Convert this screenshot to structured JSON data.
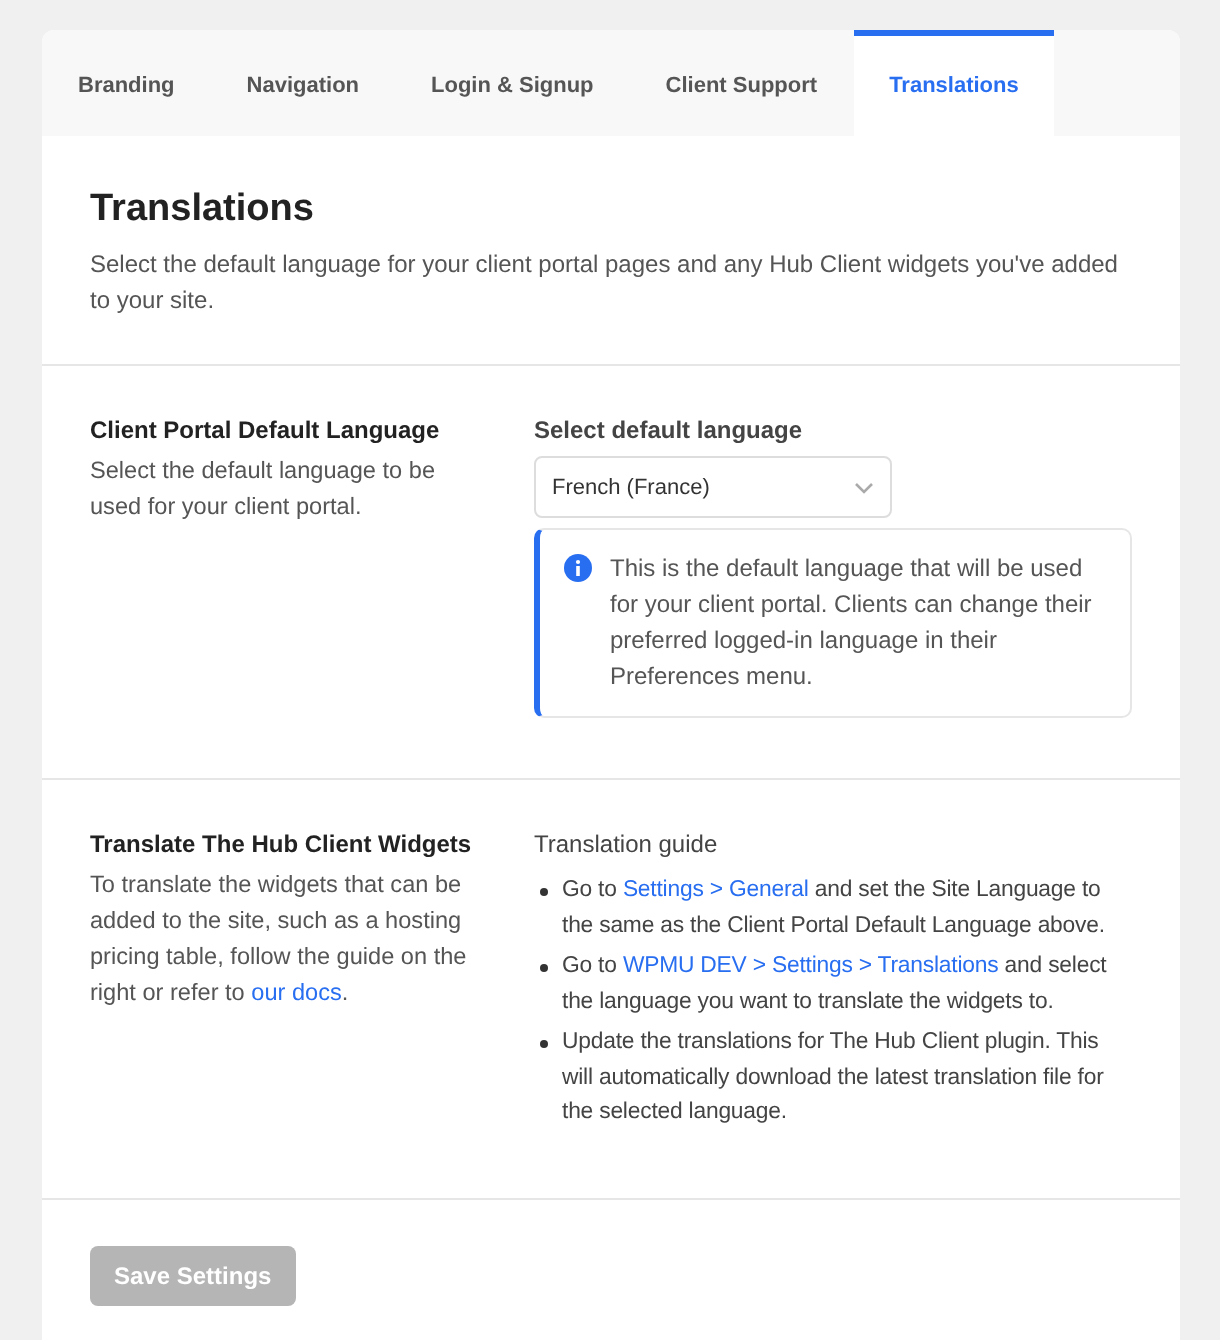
{
  "tabs": [
    {
      "label": "Branding",
      "selected": false
    },
    {
      "label": "Navigation",
      "selected": false
    },
    {
      "label": "Login & Signup",
      "selected": false
    },
    {
      "label": "Client Support",
      "selected": false
    },
    {
      "label": "Translations",
      "selected": true
    }
  ],
  "header": {
    "title": "Translations",
    "description": "Select the default language for your client portal pages and any Hub Client widgets you've added to your site."
  },
  "default_language": {
    "title": "Client Portal Default Language",
    "description": [
      {
        "text": "Select the default language to be used for your client portal.",
        "link": false
      }
    ],
    "select_label": "Select default language",
    "select_value": "French (France)",
    "notice": "This is the default language that will be used for your client portal. Clients can change their preferred logged-in language in their Preferences menu."
  },
  "widgets": {
    "title": "Translate The Hub Client Widgets",
    "description": [
      {
        "text": "To translate the widgets that can be added to the site, such as a hosting pricing table, follow the guide on the right or refer to ",
        "link": false
      },
      {
        "text": "our docs",
        "link": true
      },
      {
        "text": ".",
        "link": false
      }
    ],
    "guide_title": "Translation guide",
    "steps": [
      [
        {
          "text": "Go to ",
          "link": false
        },
        {
          "text": "Settings > General",
          "link": true
        },
        {
          "text": " and set the Site Language to the same as the Client Portal Default Language above.",
          "link": false
        }
      ],
      [
        {
          "text": "Go to ",
          "link": false
        },
        {
          "text": "WPMU DEV > Settings > Translations",
          "link": true
        },
        {
          "text": " and select the language you want to translate the widgets to.",
          "link": false
        }
      ],
      [
        {
          "text": "Update the translations for The Hub Client plugin. This will automatically download the latest translation file for the selected language.",
          "link": false
        }
      ]
    ]
  },
  "save_button": {
    "label": "Save Settings",
    "disabled": true
  }
}
